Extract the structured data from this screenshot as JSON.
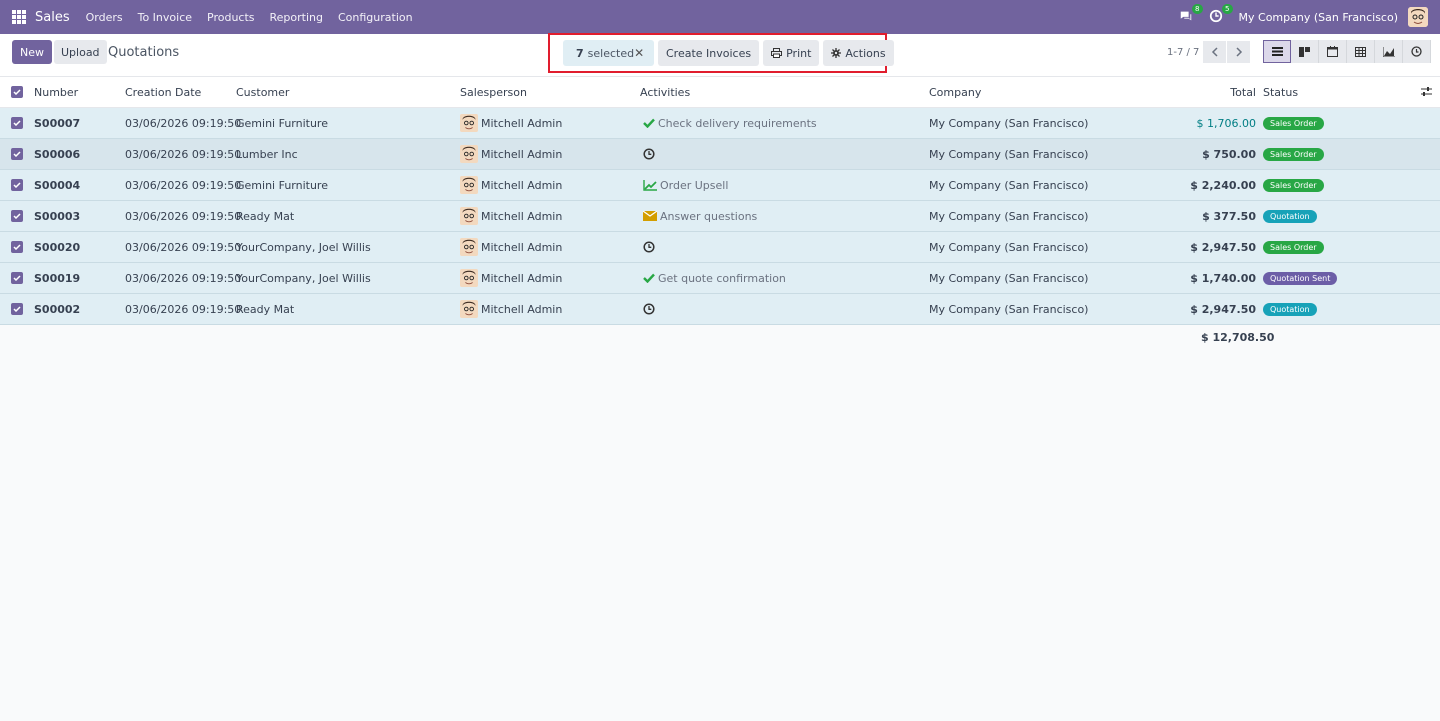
{
  "navbar": {
    "app_name": "Sales",
    "menu": [
      "Orders",
      "To Invoice",
      "Products",
      "Reporting",
      "Configuration"
    ],
    "messages_count": "8",
    "activities_count": "5",
    "company": "My Company (San Francisco)"
  },
  "control": {
    "new_label": "New",
    "upload_label": "Upload",
    "breadcrumb": "Quotations",
    "selected_count": "7",
    "selected_label": "selected",
    "create_invoices_label": "Create Invoices",
    "print_label": "Print",
    "actions_label": "Actions",
    "pager": "1-7 / 7"
  },
  "table": {
    "headers": {
      "number": "Number",
      "date": "Creation Date",
      "customer": "Customer",
      "salesperson": "Salesperson",
      "activities": "Activities",
      "company": "Company",
      "total": "Total",
      "status": "Status"
    },
    "rows": [
      {
        "number": "S00007",
        "date": "03/06/2026 09:19:50",
        "customer": "Gemini Furniture",
        "salesperson": "Mitchell Admin",
        "activity_icon": "check-icon",
        "activity": "Check delivery requirements",
        "company": "My Company (San Francisco)",
        "total": "$ 1,706.00",
        "status": "Sales Order",
        "status_color": "#28a745"
      },
      {
        "number": "S00006",
        "date": "03/06/2026 09:19:50",
        "customer": "Lumber Inc",
        "salesperson": "Mitchell Admin",
        "activity_icon": "clock-icon",
        "activity": "",
        "company": "My Company (San Francisco)",
        "total": "$ 750.00",
        "status": "Sales Order",
        "status_color": "#28a745"
      },
      {
        "number": "S00004",
        "date": "03/06/2026 09:19:50",
        "customer": "Gemini Furniture",
        "salesperson": "Mitchell Admin",
        "activity_icon": "chart-icon",
        "activity": "Order Upsell",
        "company": "My Company (San Francisco)",
        "total": "$ 2,240.00",
        "status": "Sales Order",
        "status_color": "#28a745"
      },
      {
        "number": "S00003",
        "date": "03/06/2026 09:19:50",
        "customer": "Ready Mat",
        "salesperson": "Mitchell Admin",
        "activity_icon": "envelope-icon",
        "activity": "Answer questions",
        "company": "My Company (San Francisco)",
        "total": "$ 377.50",
        "status": "Quotation",
        "status_color": "#17a2b8"
      },
      {
        "number": "S00020",
        "date": "03/06/2026 09:19:50",
        "customer": "YourCompany, Joel Willis",
        "salesperson": "Mitchell Admin",
        "activity_icon": "clock-icon",
        "activity": "",
        "company": "My Company (San Francisco)",
        "total": "$ 2,947.50",
        "status": "Sales Order",
        "status_color": "#28a745"
      },
      {
        "number": "S00019",
        "date": "03/06/2026 09:19:50",
        "customer": "YourCompany, Joel Willis",
        "salesperson": "Mitchell Admin",
        "activity_icon": "check-icon",
        "activity": "Get quote confirmation",
        "company": "My Company (San Francisco)",
        "total": "$ 1,740.00",
        "status": "Quotation Sent",
        "status_color": "#6c5ea7"
      },
      {
        "number": "S00002",
        "date": "03/06/2026 09:19:50",
        "customer": "Ready Mat",
        "salesperson": "Mitchell Admin",
        "activity_icon": "clock-icon",
        "activity": "",
        "company": "My Company (San Francisco)",
        "total": "$ 2,947.50",
        "status": "Quotation",
        "status_color": "#17a2b8"
      }
    ],
    "grand_total": "$ 12,708.50"
  },
  "colors": {
    "brand": "#71639e",
    "selected_row": "#e0eef4",
    "highlight_box": "#e11d2e"
  }
}
